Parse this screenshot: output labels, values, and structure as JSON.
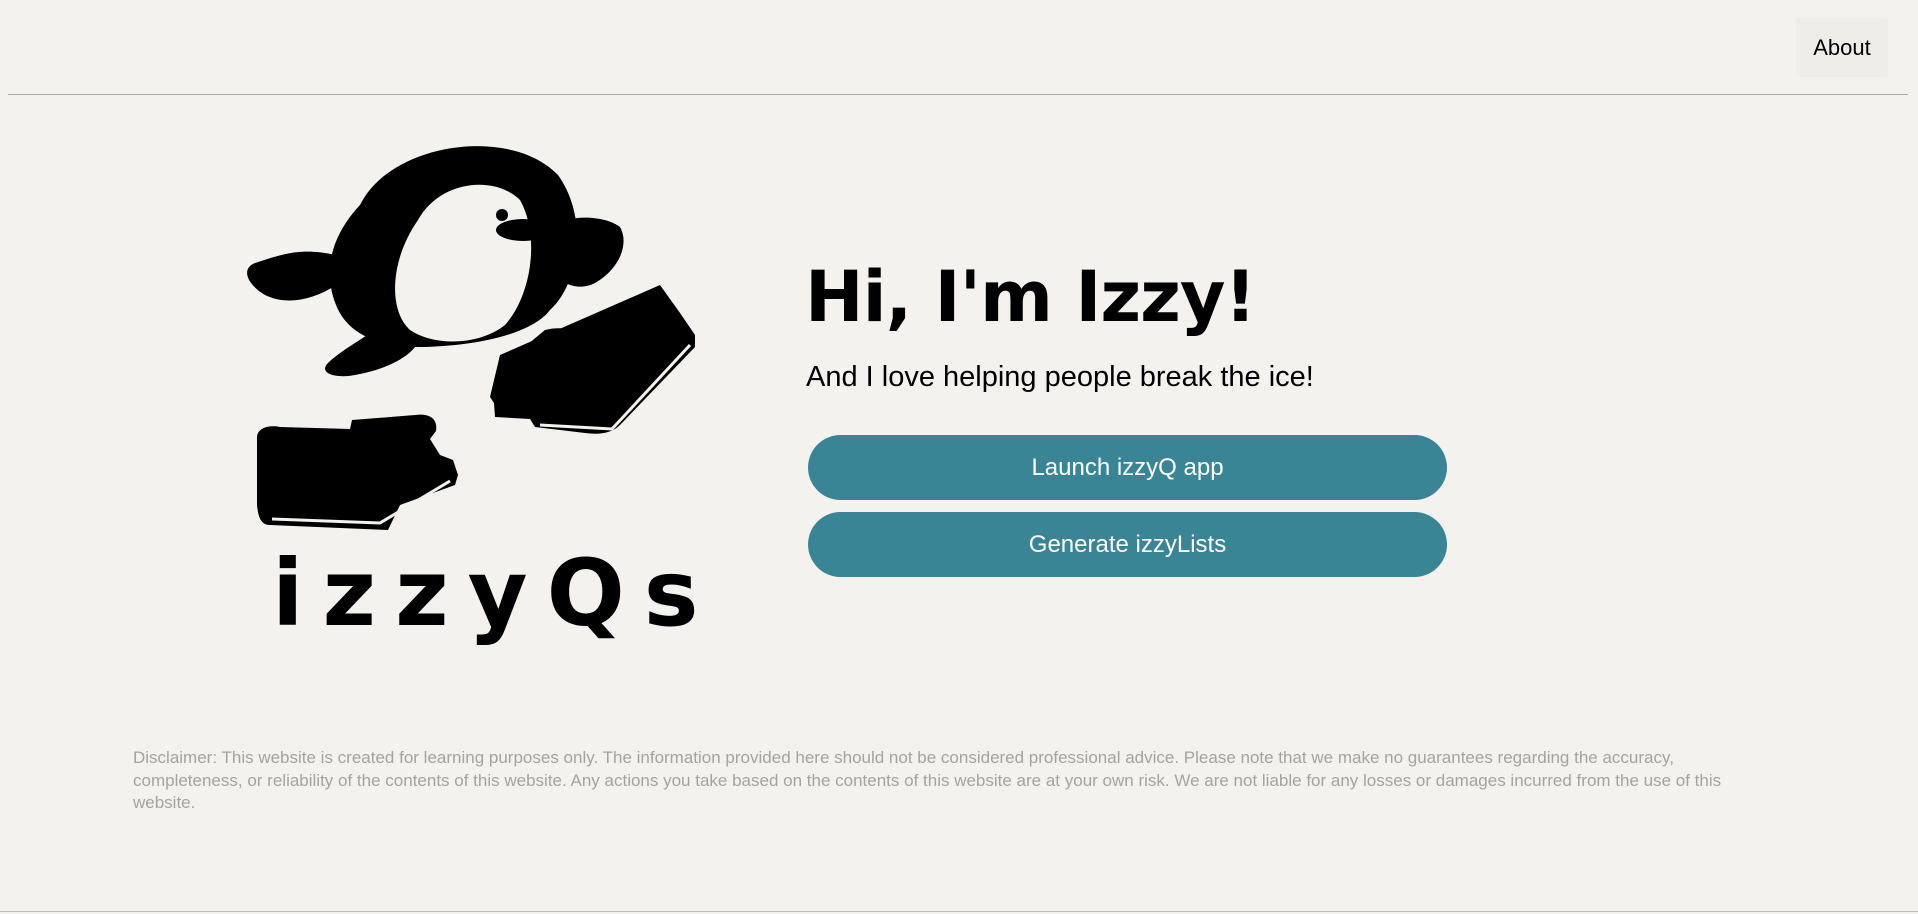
{
  "header": {
    "about_label": "About"
  },
  "brand": {
    "wordmark": "izzyQs"
  },
  "hero": {
    "title": "Hi, I'm Izzy!",
    "subtitle": "And I love helping people break the ice!",
    "primary_button": "Launch izzyQ app",
    "secondary_button": "Generate izzyLists"
  },
  "footer": {
    "disclaimer": "Disclaimer: This website is created for learning purposes only. The information provided here should not be considered professional advice. Please note that we make no guarantees regarding the accuracy, completeness, or reliability of the contents of this website. Any actions you take based on the contents of this website are at your own risk. We are not liable for any losses or damages incurred from the use of this website."
  },
  "theme": {
    "background": "#f3f2ee",
    "accent": "#3a8595",
    "text": "#000000",
    "muted_text": "#a3a3a0"
  },
  "icons": {
    "logo": "penguin-on-ice-floes-icon"
  }
}
